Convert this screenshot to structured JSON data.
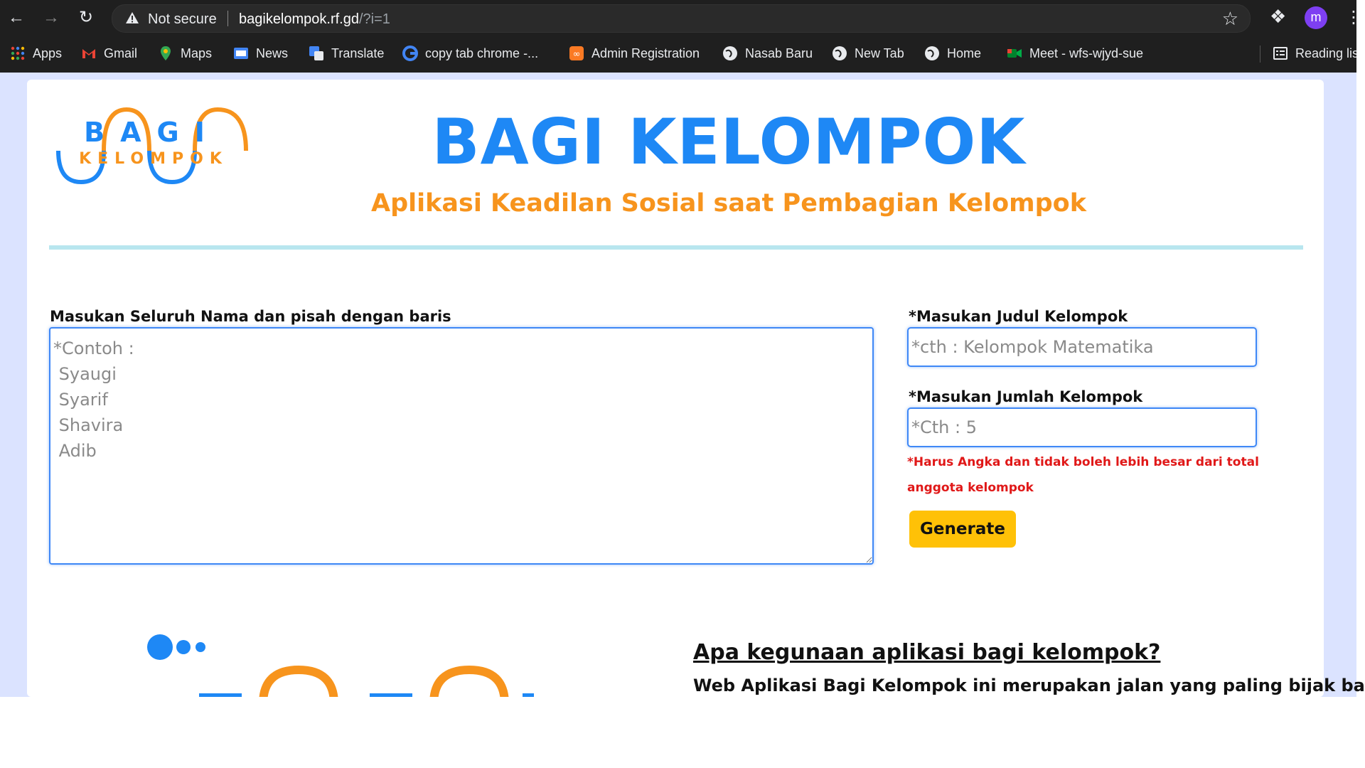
{
  "browser": {
    "security_label": "Not secure",
    "url_host": "bagikelompok.rf.gd",
    "url_path": "/?i=1",
    "avatar_letter": "m"
  },
  "bookmarks": [
    {
      "label": "Apps",
      "icon": "apps-grid-icon"
    },
    {
      "label": "Gmail",
      "icon": "gmail-icon"
    },
    {
      "label": "Maps",
      "icon": "maps-icon"
    },
    {
      "label": "News",
      "icon": "news-icon"
    },
    {
      "label": "Translate",
      "icon": "translate-icon"
    },
    {
      "label": "copy tab chrome -...",
      "icon": "google-icon"
    },
    {
      "label": "Admin Registration",
      "icon": "xampp-icon"
    },
    {
      "label": "Nasab Baru",
      "icon": "globe-icon"
    },
    {
      "label": "New Tab",
      "icon": "globe-icon"
    },
    {
      "label": "Home",
      "icon": "globe-icon"
    },
    {
      "label": "Meet - wfs-wjyd-sue",
      "icon": "meet-icon"
    },
    {
      "label": "Reading list",
      "icon": "reading-list-icon"
    }
  ],
  "header": {
    "logo_text_top": "BAGI",
    "logo_text_bottom": "KELOMPOK",
    "title": "BAGI KELOMPOK",
    "subtitle": "Aplikasi Keadilan Sosial saat Pembagian Kelompok"
  },
  "form": {
    "names_label": "Masukan Seluruh Nama dan pisah dengan baris",
    "names_placeholder": "*Contoh :\n Syaugi\n Syarif\n Shavira\n Adib",
    "group_title_label": "*Masukan Judul Kelompok",
    "group_title_placeholder": "*cth : Kelompok Matematika",
    "group_count_label": "*Masukan Jumlah Kelompok",
    "group_count_placeholder": "*Cth : 5",
    "warning": "*Harus Angka dan tidak boleh lebih besar dari total anggota kelompok",
    "generate_label": "Generate"
  },
  "about": {
    "question": "Apa kegunaan aplikasi bagi kelompok?",
    "answer": "Web Aplikasi Bagi Kelompok ini merupakan jalan yang paling bijak bagi"
  },
  "colors": {
    "brand_blue": "#1e88f5",
    "brand_orange": "#f7941d",
    "button_yellow": "#ffc107",
    "warning_red": "#e01818"
  }
}
